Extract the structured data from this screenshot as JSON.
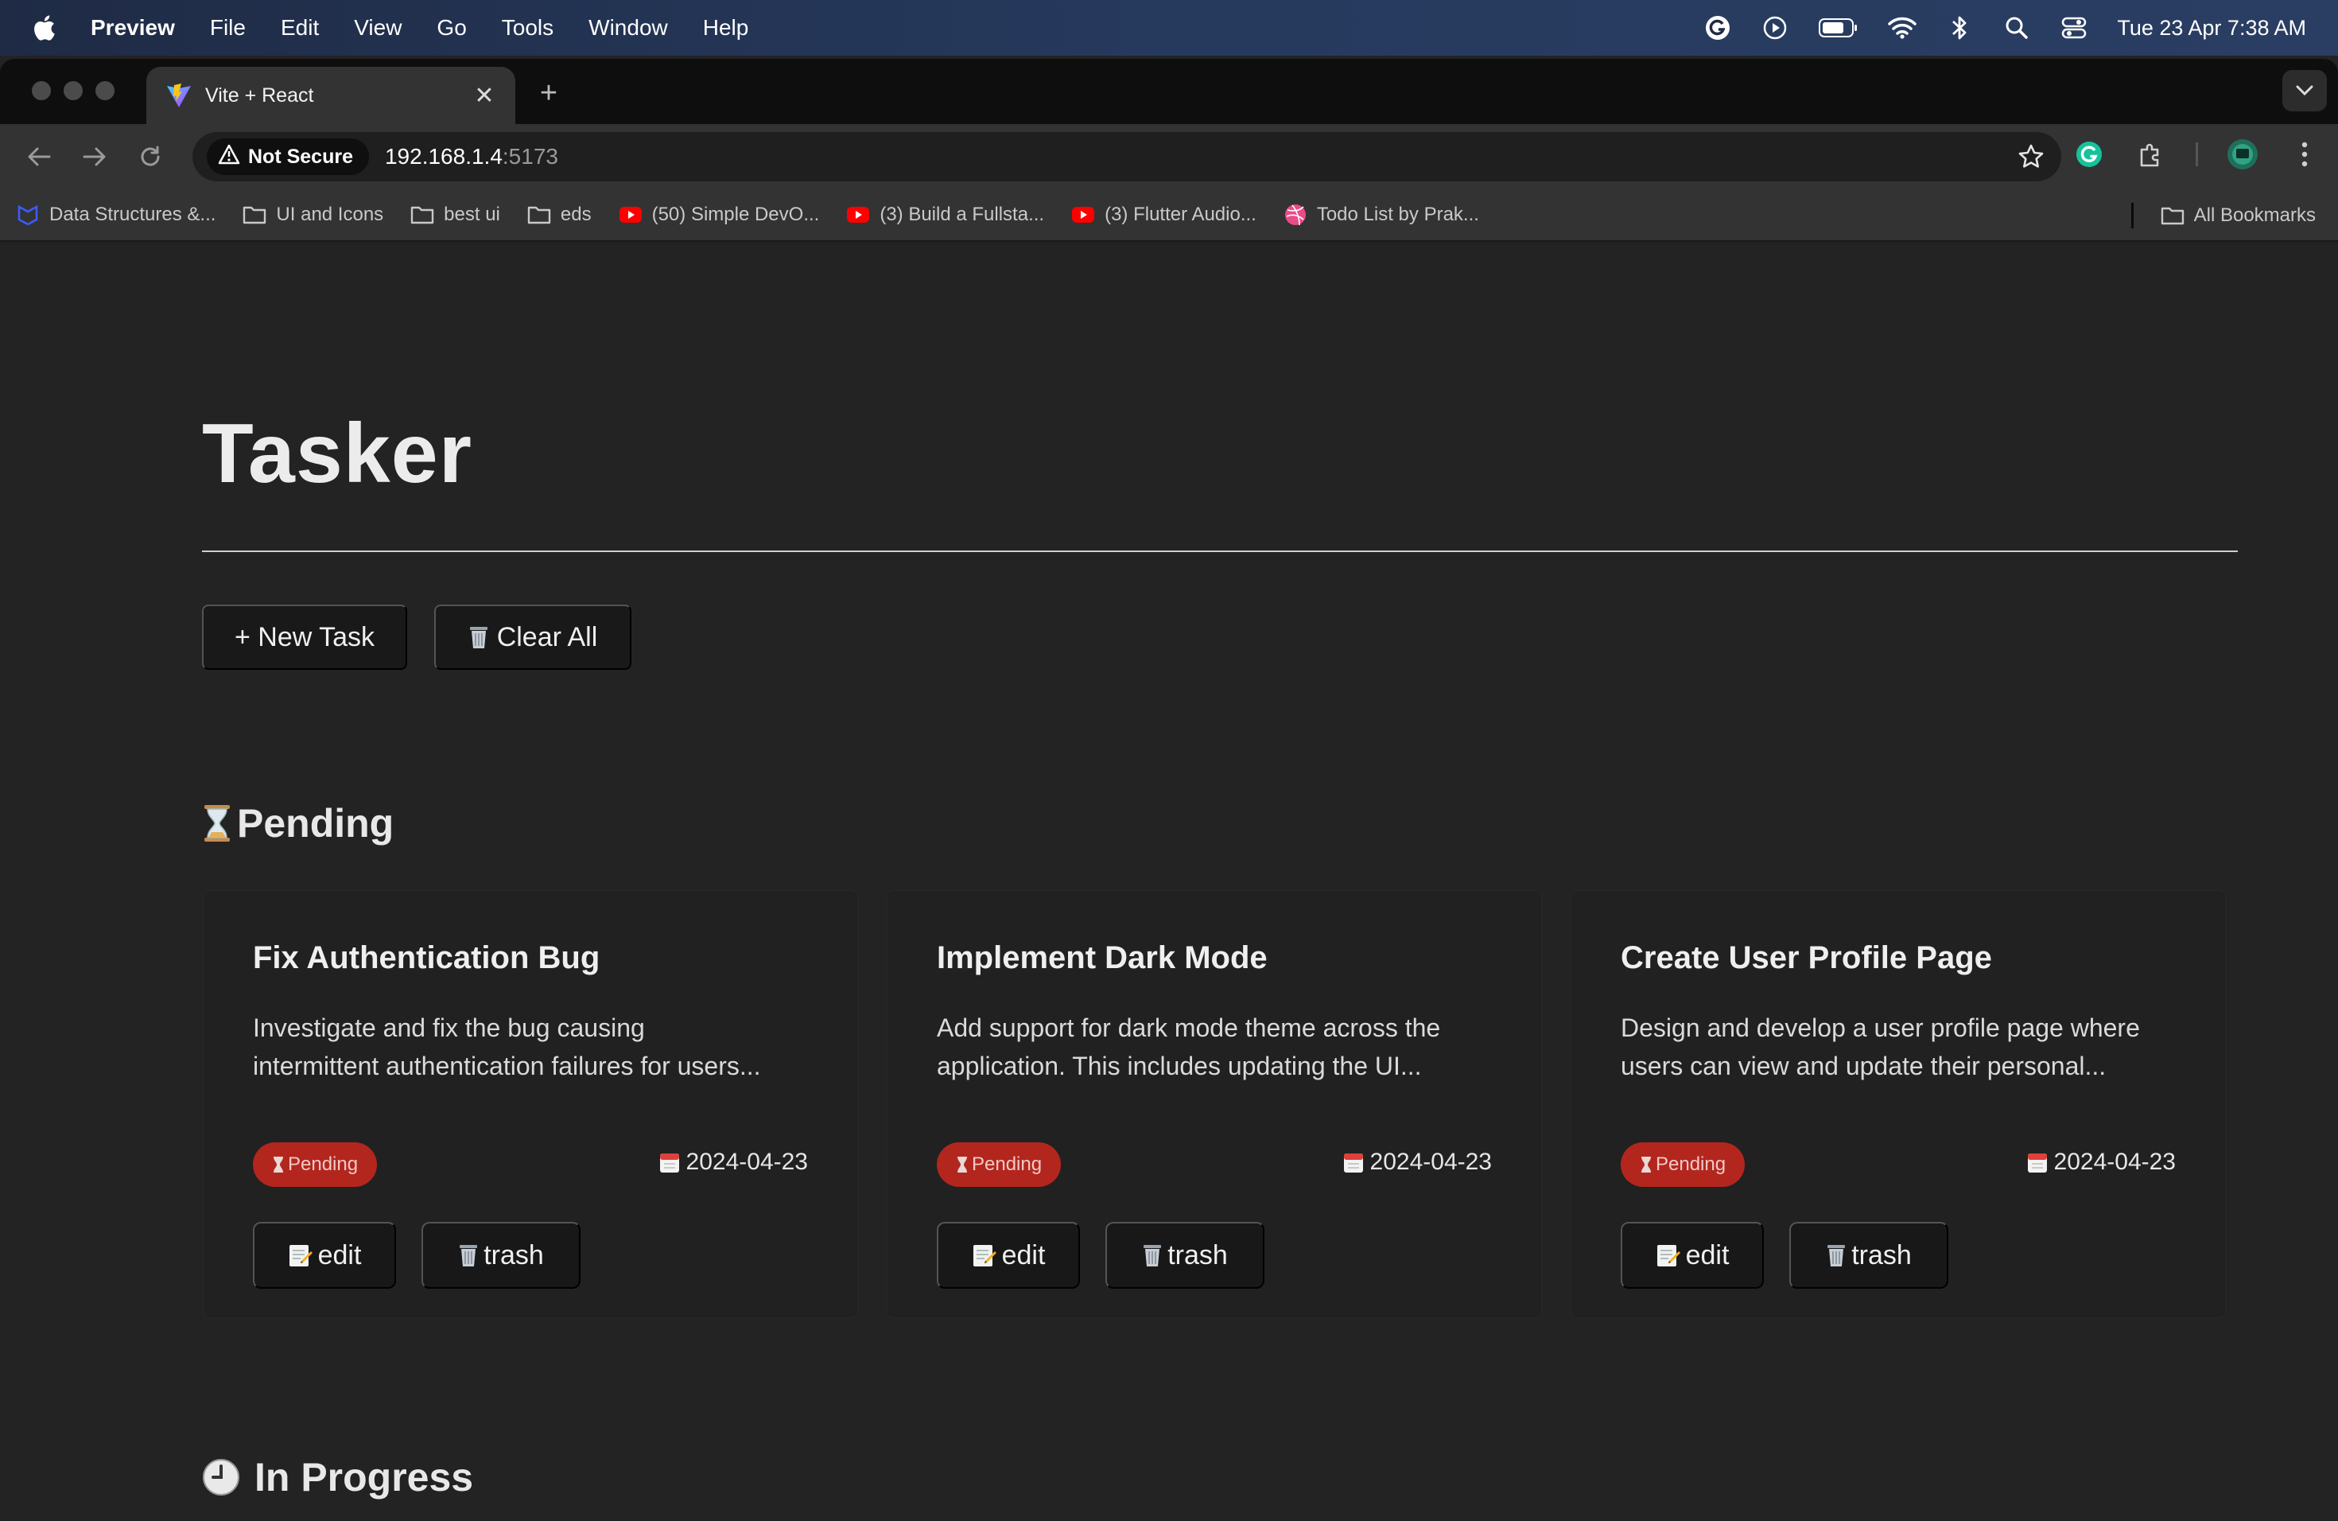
{
  "menubar": {
    "app": "Preview",
    "items": [
      "File",
      "Edit",
      "View",
      "Go",
      "Tools",
      "Window",
      "Help"
    ],
    "clock": "Tue 23 Apr  7:38 AM"
  },
  "browser": {
    "tab": {
      "title": "Vite + React",
      "close": "✕"
    },
    "new_tab": "+",
    "security_label": "Not Secure",
    "url_host": "192.168.1.4",
    "url_port": ":5173",
    "bookmarks": [
      {
        "label": "Data Structures &...",
        "icon": "bookmark-site-icon"
      },
      {
        "label": "UI and Icons",
        "icon": "folder-icon"
      },
      {
        "label": "best ui",
        "icon": "folder-icon"
      },
      {
        "label": "eds",
        "icon": "folder-icon"
      },
      {
        "label": "(50) Simple DevO...",
        "icon": "youtube-icon"
      },
      {
        "label": "(3) Build a Fullsta...",
        "icon": "youtube-icon"
      },
      {
        "label": "(3) Flutter Audio...",
        "icon": "youtube-icon"
      },
      {
        "label": "Todo List by Prak...",
        "icon": "dribbble-icon"
      }
    ],
    "all_bookmarks": "All Bookmarks"
  },
  "app": {
    "title": "Tasker",
    "new_task_label": "+ New Task",
    "clear_all_label": "Clear All",
    "pending_heading": "Pending",
    "in_progress_heading": "In Progress",
    "edit_label": "edit",
    "trash_label": "trash",
    "tasks": [
      {
        "title": "Fix Authentication Bug",
        "desc_line1": "Investigate and fix the bug causing",
        "desc_line2": "intermittent authentication failures for users...",
        "status": "Pending",
        "date": "2024-04-23"
      },
      {
        "title": "Implement Dark Mode",
        "desc_line1": "Add support for dark mode theme across the",
        "desc_line2": "application. This includes updating the UI...",
        "status": "Pending",
        "date": "2024-04-23"
      },
      {
        "title": "Create User Profile Page",
        "desc_line1": "Design and develop a user profile page where",
        "desc_line2": "users can view and update their personal...",
        "status": "Pending",
        "date": "2024-04-23"
      }
    ]
  },
  "colors": {
    "page_bg": "#232323",
    "card_bg": "#212121",
    "button_bg": "#191919",
    "status_pending": "#b3261e"
  }
}
